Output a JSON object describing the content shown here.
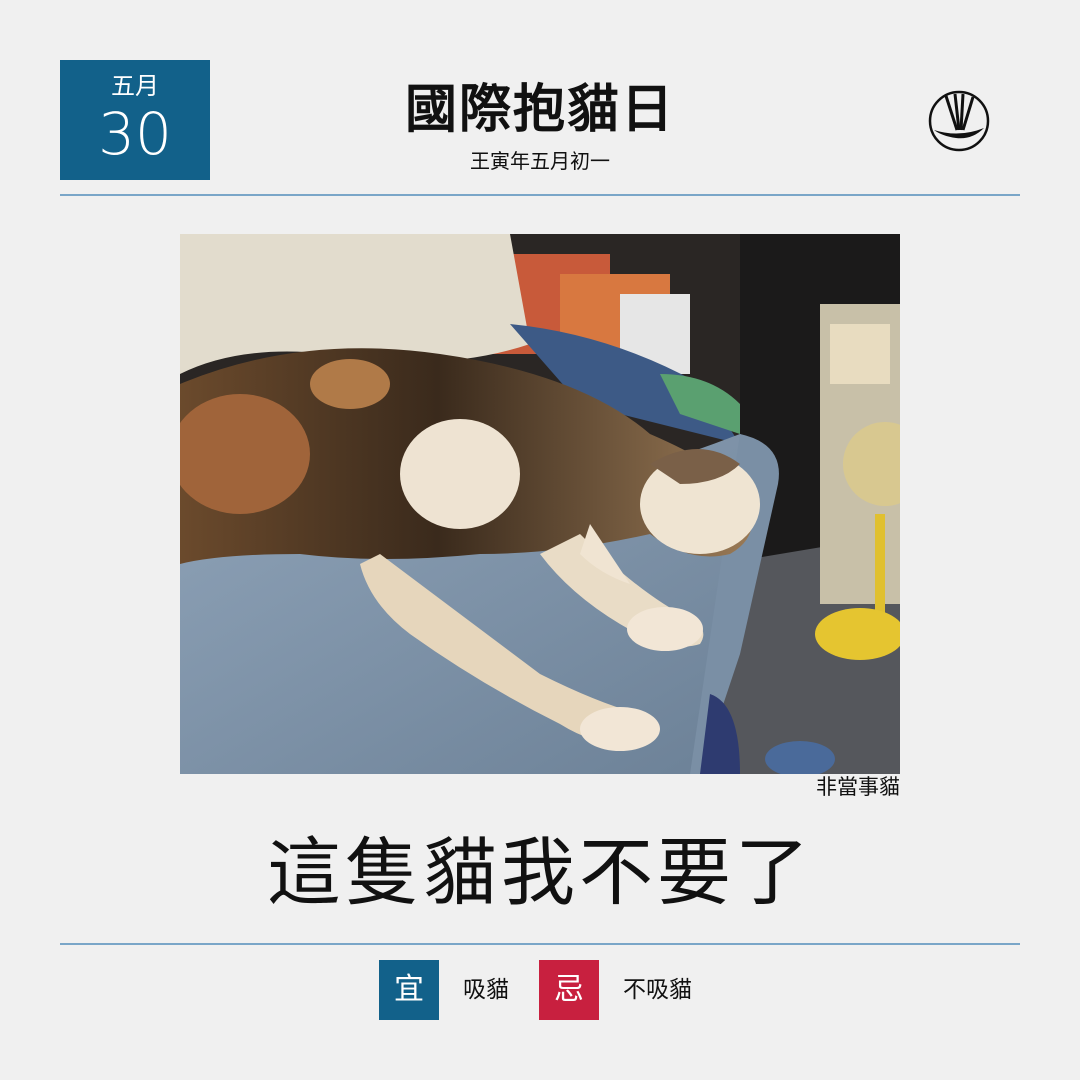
{
  "date": {
    "month": "五月",
    "day": "30"
  },
  "title": "國際抱貓日",
  "subtitle": "王寅年五月初一",
  "logo": {
    "icon": "brush-circle-logo-icon"
  },
  "photo": {
    "caption": "非當事貓"
  },
  "headline": "這隻貓我不要了",
  "footer": {
    "good": {
      "badge": "宜",
      "text": "吸貓",
      "color": "#12618a"
    },
    "bad": {
      "badge": "忌",
      "text": "不吸貓",
      "color": "#c8203f"
    }
  },
  "colors": {
    "accent": "#12618a",
    "rule": "#7aa6c8",
    "background": "#f0f0f0"
  }
}
